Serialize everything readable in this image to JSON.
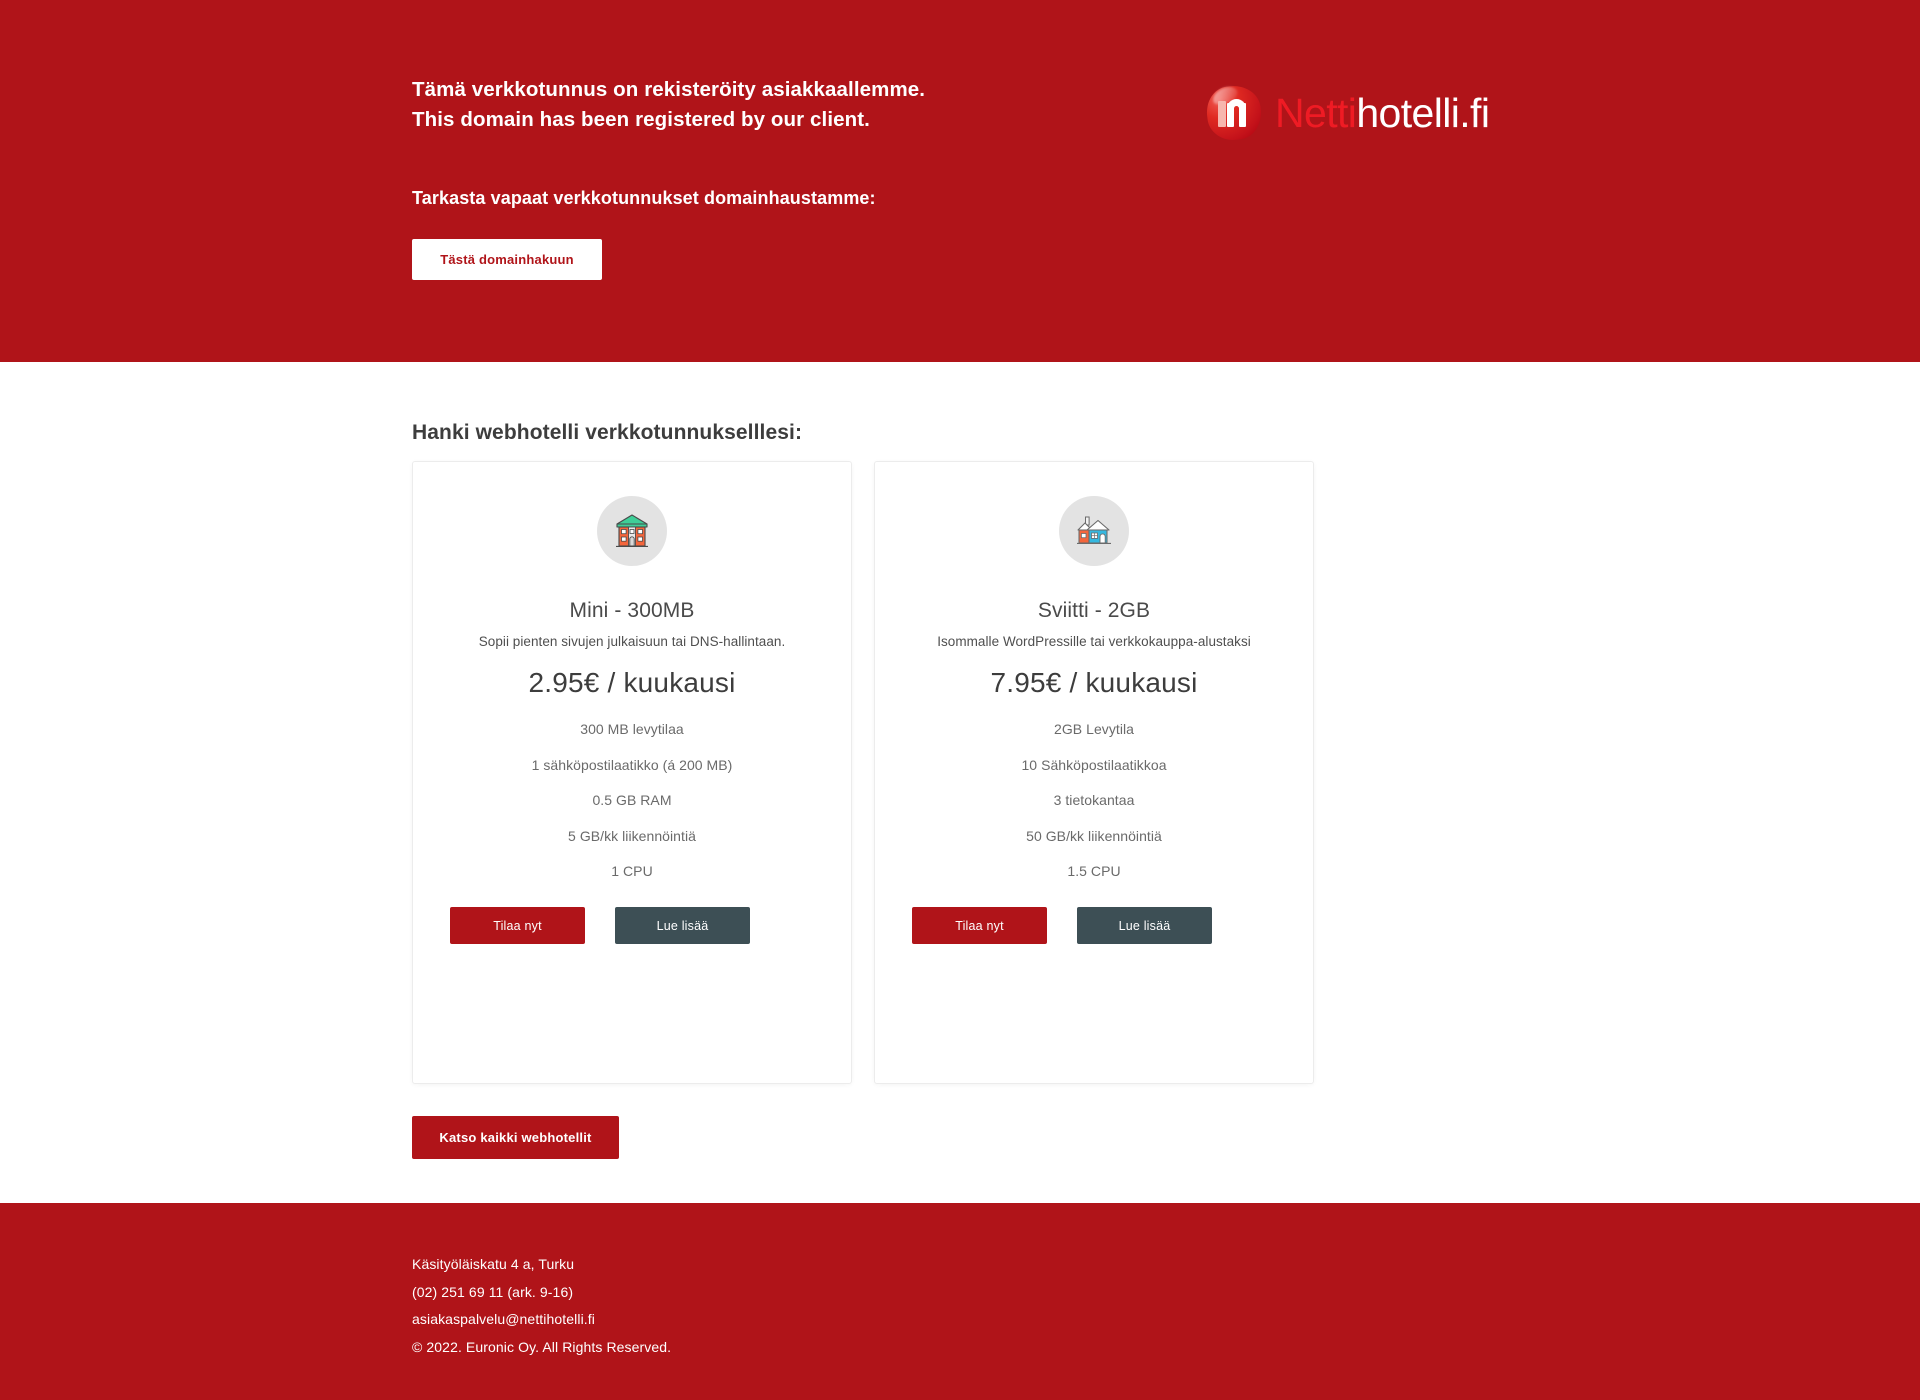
{
  "header": {
    "headline_fi": "Tämä verkkotunnus on rekisteröity asiakkaallemme.",
    "headline_en": "This domain has been registered by our client.",
    "subhead": "Tarkasta vapaat verkkotunnukset domainhaustamme:",
    "domain_button_label": "Tästä domainhakuun",
    "logo": {
      "brand_first": "Netti",
      "brand_second": "hotelli.fi",
      "mark_letter": "n",
      "icon_name": "nettihotelli-logo-icon"
    },
    "background_color": "#b01419",
    "button_bg": "#ffffff",
    "button_text_color": "#b01419"
  },
  "main": {
    "section_title": "Hanki webhotelli verkkotunnukselllesi:",
    "all_hotels_button_label": "Katso kaikki webhotellit",
    "order_button_label": "Tilaa nyt",
    "more_button_label": "Lue lisää",
    "accent_red": "#b01419",
    "accent_slate": "#3d4f55",
    "cards": [
      {
        "icon_name": "apartment-house-icon",
        "title": "Mini - 300MB",
        "description": "Sopii pienten sivujen julkaisuun tai DNS-hallintaan.",
        "price": "2.95€ / kuukausi",
        "features": [
          "300 MB levytilaa",
          "1 sähköpostilaatikko (á 200 MB)",
          "0.5 GB RAM",
          "5 GB/kk liikennöintiä",
          "1 CPU"
        ]
      },
      {
        "icon_name": "villa-house-icon",
        "title": "Sviitti - 2GB",
        "description": "Isommalle WordPressille tai verkkokauppa-alustaksi",
        "price": "7.95€ / kuukausi",
        "features": [
          "2GB Levytila",
          "10 Sähköpostilaatikkoa",
          "3 tietokantaa",
          "50 GB/kk liikennöintiä",
          "1.5 CPU"
        ]
      }
    ]
  },
  "footer": {
    "address": "Käsityöläiskatu 4 a, Turku",
    "phone": "(02) 251 69 11 (ark. 9-16)",
    "email": "asiakaspalvelu@nettihotelli.fi",
    "copyright": "© 2022. Euronic Oy. All Rights Reserved.",
    "background_color": "#b01419"
  }
}
